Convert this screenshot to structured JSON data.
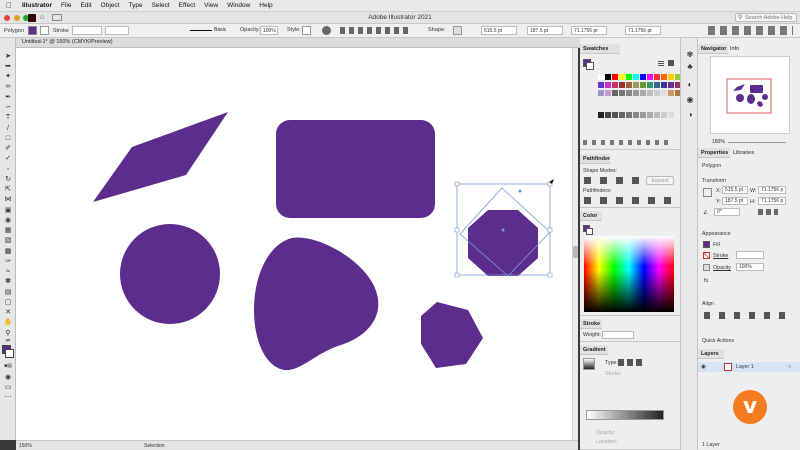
{
  "menubar": {
    "apple": "",
    "app": "Illustrator",
    "items": [
      "File",
      "Edit",
      "Object",
      "Type",
      "Select",
      "Effect",
      "View",
      "Window",
      "Help"
    ]
  },
  "titlebar": {
    "title": "Adobe Illustrator 2021",
    "search_placeholder": "Search Adobe Help"
  },
  "controlbar": {
    "selection_label": "Polygon",
    "stroke_label": "Stroke",
    "brush_label": "Basic",
    "opacity_label": "Opacity:",
    "opacity_value": "100%",
    "style_label": "Style:",
    "shape_label": "Shape:",
    "x_value": "515.5 pt",
    "y_value": "187.5 pt",
    "w_value": "71.1756 pt",
    "h_value": "71.1756 pt"
  },
  "document": {
    "tab_label": "Untitled-1* @ 150% (CMYK/Preview)",
    "zoom": "150%",
    "status_tool": "Selection",
    "fill_color": "#5c2d8c"
  },
  "swatches": {
    "title": "Swatches"
  },
  "pathfinder": {
    "title": "Pathfinder",
    "shape_modes": "Shape Modes:",
    "expand": "Expand",
    "pathfinders": "Pathfinders:"
  },
  "color": {
    "title": "Color"
  },
  "stroke": {
    "title": "Stroke",
    "weight_label": "Weight:"
  },
  "gradient": {
    "title": "Gradient",
    "type_label": "Type:",
    "stroke_label": "Stroke:",
    "opacity_label": "Opacity:",
    "location_label": "Location:"
  },
  "navigator": {
    "tab": "Navigator",
    "info_tab": "Info",
    "zoom": "150%"
  },
  "properties": {
    "tab": "Properties",
    "libraries_tab": "Libraries",
    "object": "Polygon",
    "transform": "Transform",
    "x_label": "X:",
    "x_value": "515.5 pt",
    "y_label": "Y:",
    "y_value": "187.5 pt",
    "w_label": "W:",
    "w_value": "71.1756 p",
    "h_label": "H:",
    "h_value": "71.1756 p",
    "angle_value": "0°",
    "appearance": "Appearance",
    "fill_label": "Fill",
    "stroke_label": "Stroke",
    "opacity_label": "Opacity",
    "opacity_value": "100%",
    "fx_label": "fx.",
    "align": "Align",
    "quick_actions": "Quick Actions"
  },
  "layers": {
    "tab": "Layers",
    "layer1": "Layer 1",
    "count": "1 Layer"
  }
}
